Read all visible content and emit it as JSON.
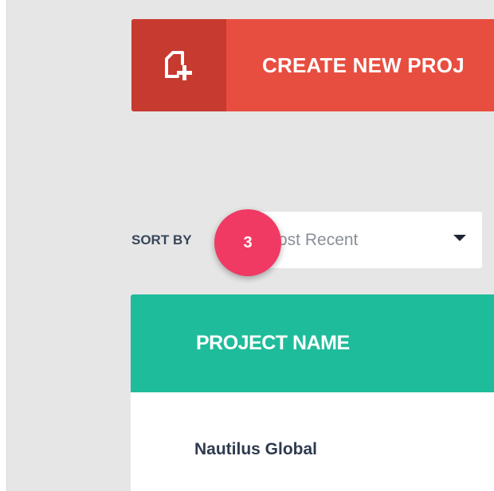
{
  "create_button": {
    "label": "CREATE NEW PROJ",
    "icon": "new-document-icon"
  },
  "sort": {
    "label": "SORT BY",
    "selected": "ost Recent",
    "icon": "caret-down-icon"
  },
  "step_badge": {
    "number": "3"
  },
  "projects_table": {
    "columns": [
      "PROJECT NAME"
    ],
    "rows": [
      {
        "name": "Nautilus Global"
      }
    ]
  },
  "colors": {
    "create_button": "#e84e40",
    "create_icon_box": "#c63a2f",
    "table_header": "#1fbc9b",
    "step_badge": "#f03a63",
    "background": "#e6e6e6"
  }
}
